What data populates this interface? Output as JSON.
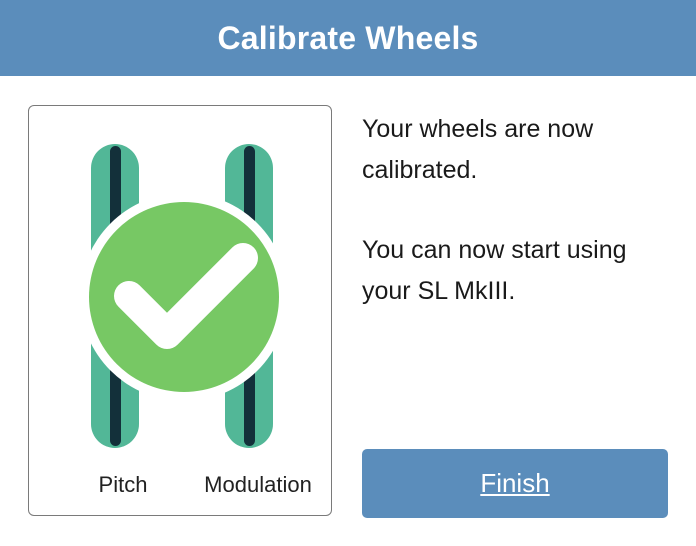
{
  "header": {
    "title": "Calibrate Wheels",
    "color": "#5b8dbb"
  },
  "wheels": {
    "pitch_label": "Pitch",
    "modulation_label": "Modulation",
    "track_color": "#52b797",
    "slot_color": "#13303a",
    "status_icon": "check-circle-icon",
    "check_color": "#77c864"
  },
  "message": {
    "line1": "Your wheels are now calibrated.",
    "line2": "You can now start using your SL MkIII."
  },
  "actions": {
    "finish_label": "Finish"
  }
}
